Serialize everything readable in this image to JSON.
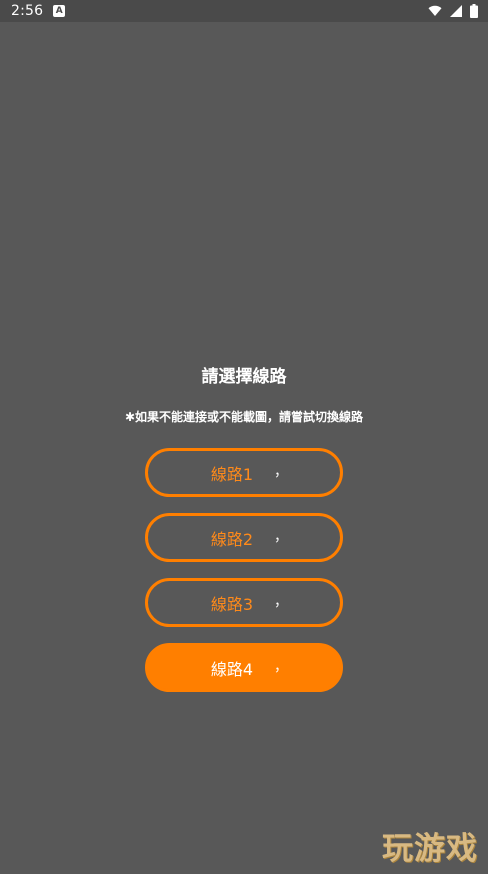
{
  "status_bar": {
    "time": "2:56",
    "app_icon_glyph": "A",
    "icons": [
      "app-notification-icon",
      "wifi-icon",
      "signal-icon",
      "battery-icon"
    ]
  },
  "dialog": {
    "title": "請選擇線路",
    "hint": "✱如果不能連接或不能載圖，請嘗試切換線路"
  },
  "routes": [
    {
      "label": "線路1",
      "suffix": "，",
      "selected": false
    },
    {
      "label": "線路2",
      "suffix": "，",
      "selected": false
    },
    {
      "label": "線路3",
      "suffix": "，",
      "selected": false
    },
    {
      "label": "線路4",
      "suffix": "，",
      "selected": true
    }
  ],
  "colors": {
    "background": "#585858",
    "status_bar": "#4a4a4a",
    "accent": "#ff7f00",
    "text": "#ffffff"
  },
  "watermark": {
    "text": "玩游戏"
  }
}
